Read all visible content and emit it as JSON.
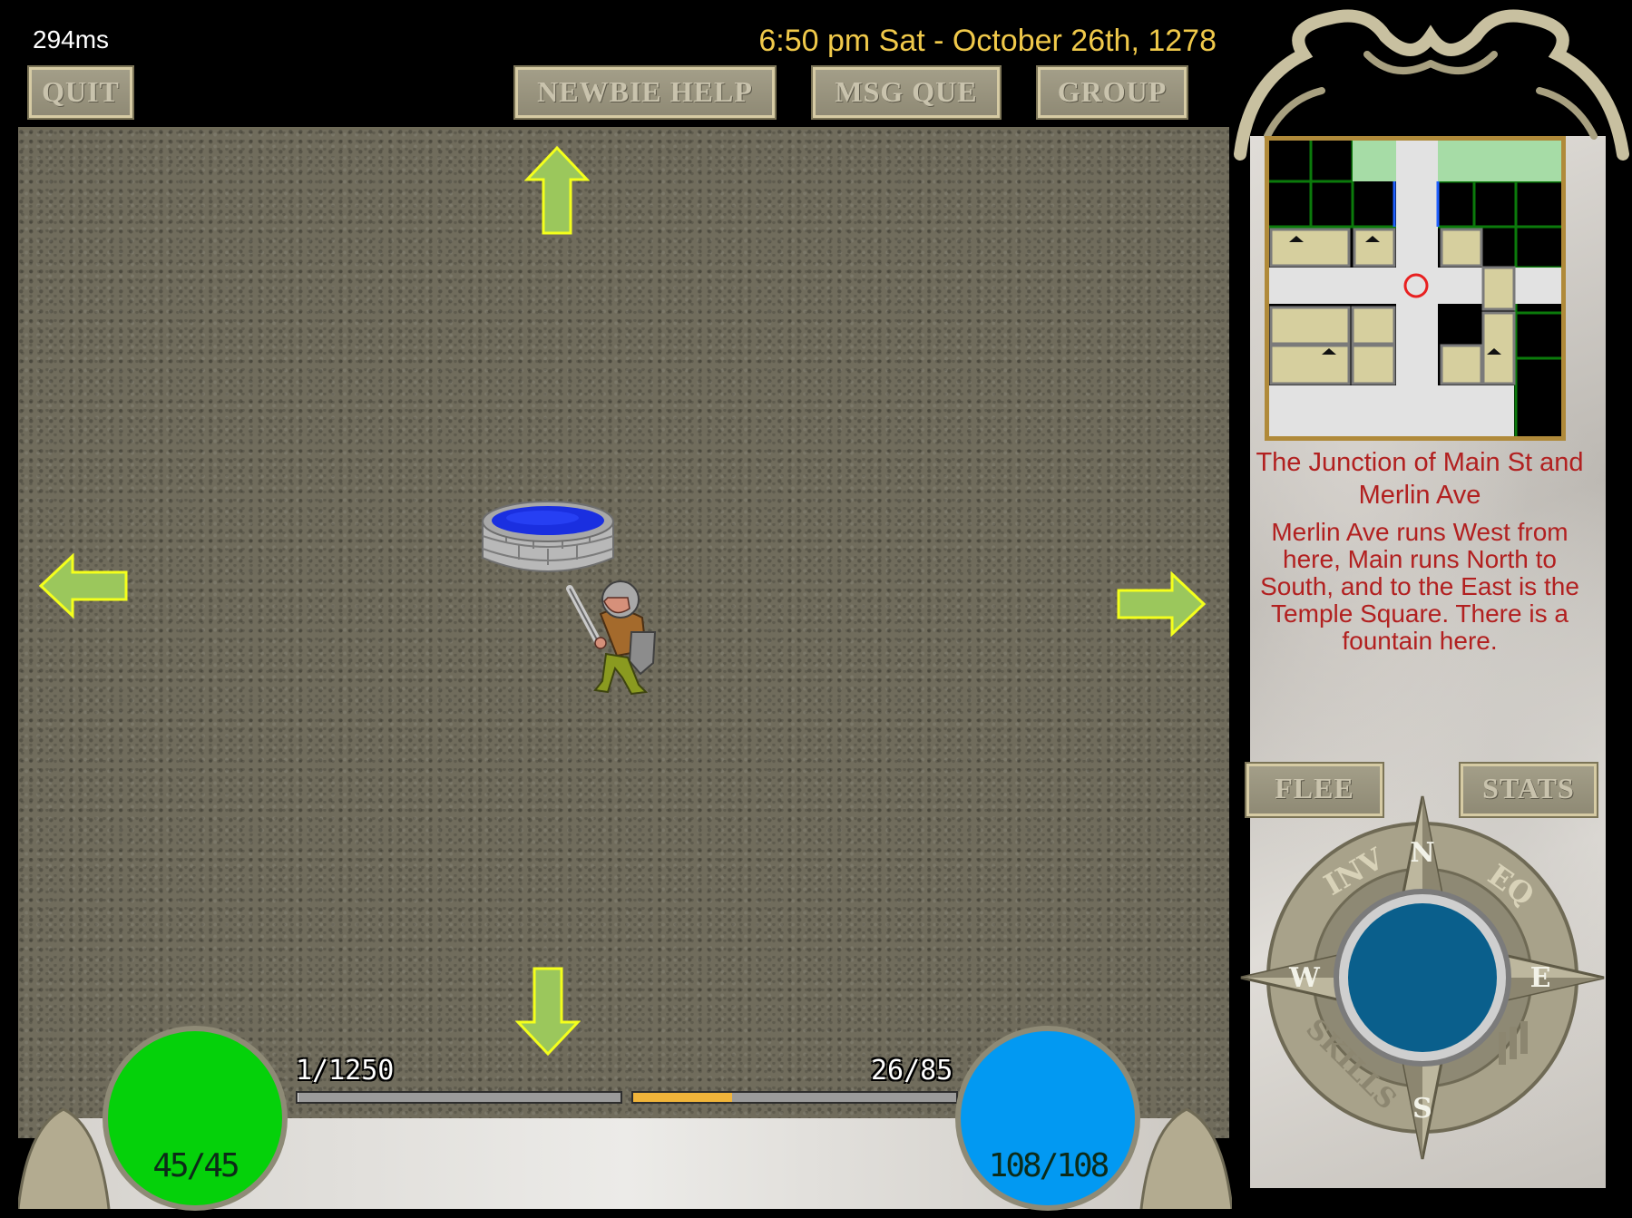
{
  "header": {
    "latency": "294ms",
    "datetime": "6:50 pm Sat - October 26th, 1278",
    "buttons": {
      "quit": "QUIT",
      "newbie_help": "NEWBIE HELP",
      "msg_que": "MSG QUE",
      "group": "GROUP"
    }
  },
  "room": {
    "title": "The Junction of Main St and Merlin Ave",
    "description": "Merlin Ave runs West from here, Main runs North to South, and to the East is the Temple Square. There is a fountain here."
  },
  "actions": {
    "flee": "FLEE",
    "stats": "STATS"
  },
  "compass": {
    "north": "N",
    "south": "S",
    "east": "E",
    "west": "W",
    "inv": "INV",
    "eq": "EQ",
    "skills": "SKILLS"
  },
  "status": {
    "health": "45/45",
    "mana": "108/108",
    "experience": "1/1250",
    "experience_fraction": 0.0008,
    "stamina": "26/85",
    "stamina_fraction": 0.306
  },
  "colors": {
    "health_orb": "#05d10a",
    "mana_orb": "#0299f2",
    "room_text": "#b22020",
    "clock_text": "#f0c94a",
    "arrow_fill": "#9bc75c",
    "arrow_stroke": "#f4ff1c",
    "stamina_bar": "#f0b43a"
  },
  "icons": [
    "move-north-arrow-icon",
    "move-south-arrow-icon",
    "move-west-arrow-icon",
    "move-east-arrow-icon",
    "fountain-icon",
    "player-knight-icon",
    "player-location-marker-icon",
    "compass-icon"
  ]
}
